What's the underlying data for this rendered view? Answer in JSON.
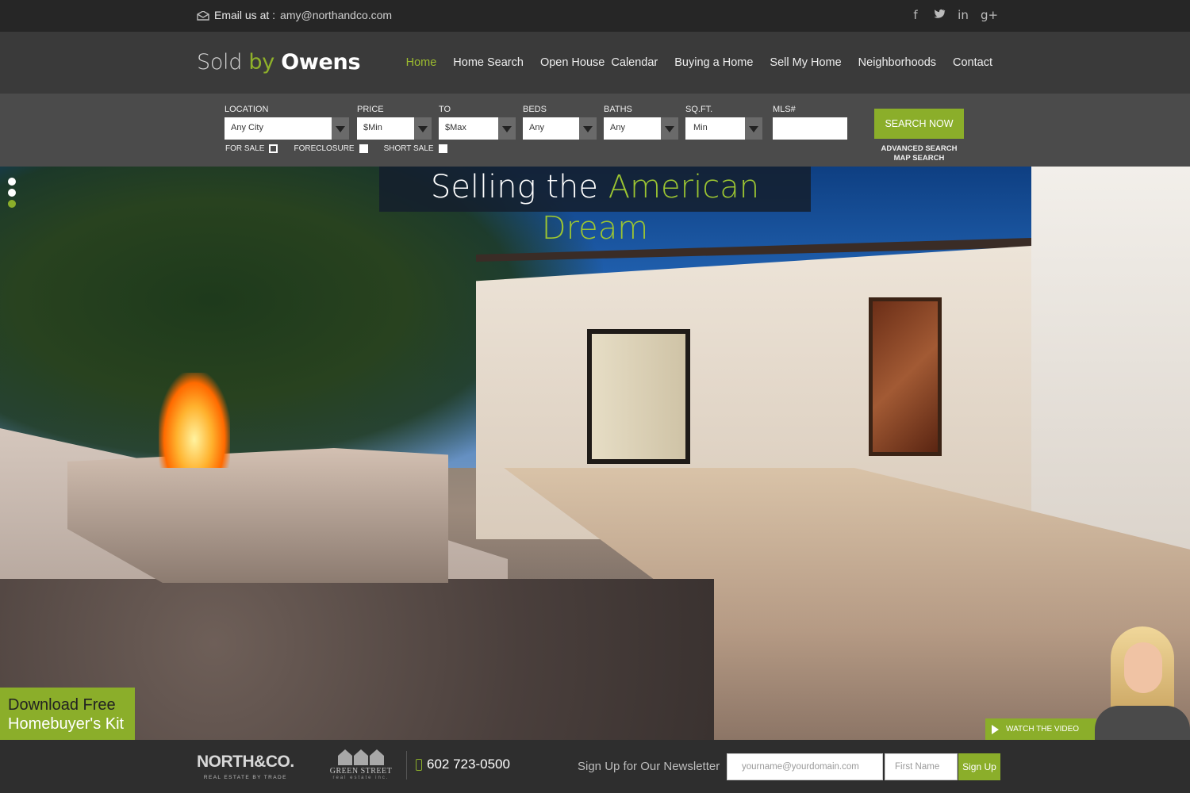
{
  "topbar": {
    "email_label": "Email us at :",
    "email_value": "amy@northandco.com",
    "social": [
      {
        "icon": "facebook-icon",
        "glyph": "f"
      },
      {
        "icon": "twitter-icon",
        "glyph": "🐦"
      },
      {
        "icon": "linkedin-icon",
        "glyph": "in"
      },
      {
        "icon": "google-plus-icon",
        "glyph": "g+"
      }
    ]
  },
  "header": {
    "logo": {
      "sold": "Sold",
      "by": "by",
      "owens": "Owens"
    },
    "nav": [
      "Home",
      "Home Search",
      "Open House  Calendar",
      "Buying a Home",
      "Sell My Home",
      "Neighborhoods",
      "Contact"
    ],
    "active_nav": "Home"
  },
  "search": {
    "location_label": "LOCATION",
    "location_value": "Any City",
    "price_label": "PRICE",
    "price_min": "$Min",
    "to_label": "TO",
    "price_max": "$Max",
    "beds_label": "BEDS",
    "beds_value": "Any",
    "baths_label": "BATHS",
    "baths_value": "Any",
    "sqft_label": "SQ.FT.",
    "sqft_value": "Min",
    "mls_label": "MLS#",
    "mls_value": "",
    "for_sale": "FOR SALE",
    "foreclosure": "FORECLOSURE",
    "short_sale": "SHORT SALE",
    "search_button": "SEARCH NOW",
    "advanced_search": "ADVANCED SEARCH",
    "map_search": "MAP SEARCH"
  },
  "hero": {
    "title_plain": "Selling the",
    "title_accent": "American Dream",
    "slides": 3,
    "active_slide": 3,
    "kit_line1": "Download Free",
    "kit_line2": "Homebuyer's Kit",
    "watch_video": "WATCH THE VIDEO"
  },
  "footer": {
    "brand1": "NORTH&CO.",
    "brand1_tag": "REAL ESTATE BY TRADE",
    "brand2": "GREEN STREET",
    "brand2_tag": "real estate inc.",
    "phone": "602 723-0500",
    "newsletter_label": "Sign Up for Our Newsletter",
    "email_placeholder": "yourname@yourdomain.com",
    "first_name_placeholder": "First Name",
    "signup_button": "Sign Up"
  },
  "colors": {
    "accent": "#8bae2a",
    "topbar": "#262626",
    "header": "#3a3a3a",
    "searchbar": "#4b4b4b",
    "footer": "#2e2e2e"
  }
}
